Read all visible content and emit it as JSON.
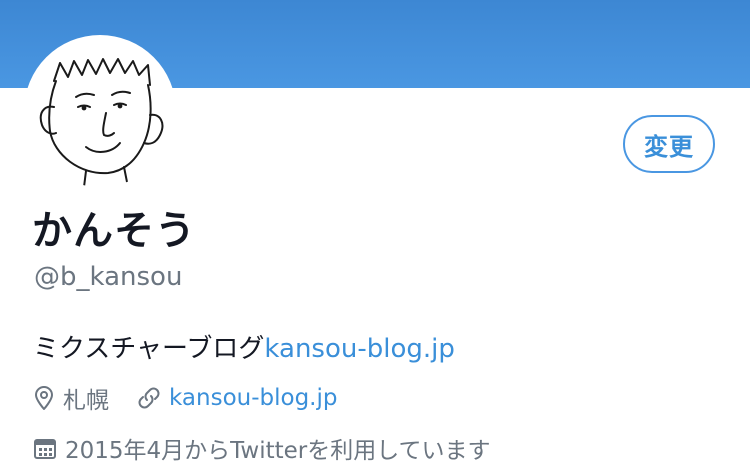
{
  "profile": {
    "display_name": "かんそう",
    "handle": "@b_kansou",
    "edit_button_label": "変更",
    "bio_text": "ミクスチャーブログ",
    "bio_link": "kansou-blog.jp",
    "location": "札幌",
    "website": "kansou-blog.jp",
    "joined": "2015年4月からTwitterを利用しています"
  },
  "icons": {
    "avatar": "avatar-illustration",
    "location": "location-pin-icon",
    "website": "link-icon",
    "joined": "calendar-icon"
  },
  "colors": {
    "banner": "#4a97e2",
    "accent": "#3a8fd9",
    "text_primary": "#141823",
    "text_secondary": "#6b7580"
  }
}
